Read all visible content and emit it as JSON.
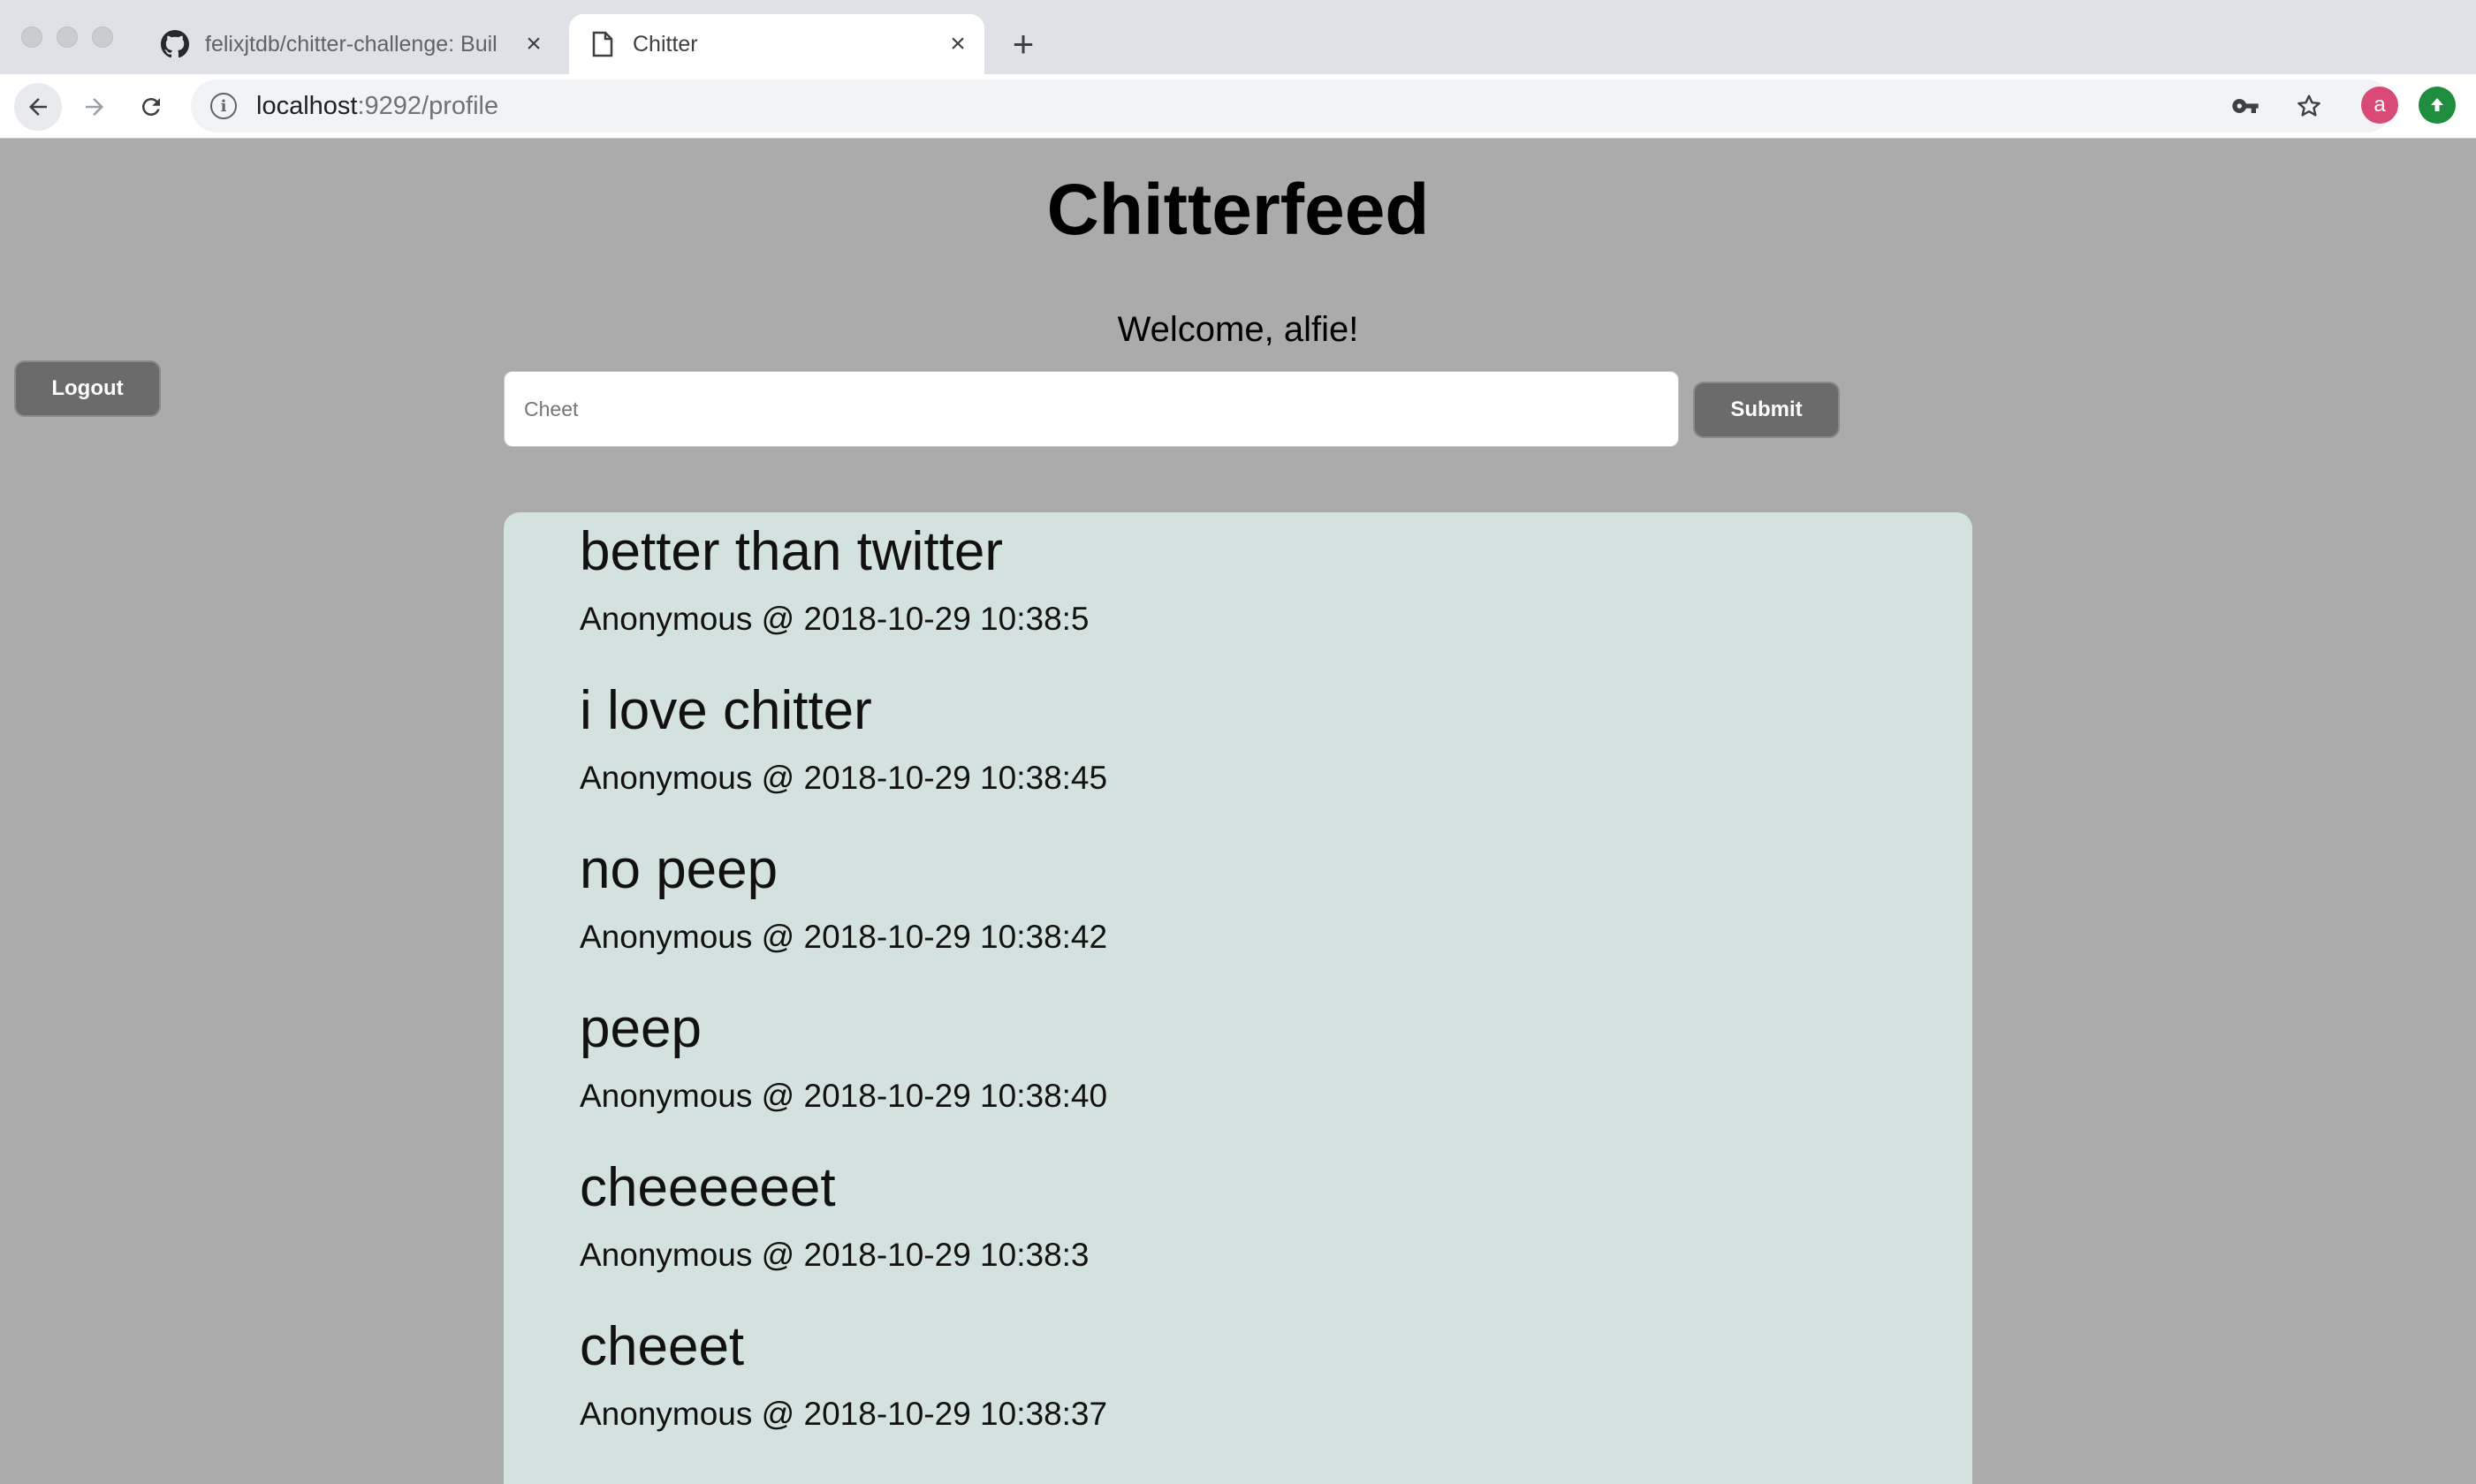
{
  "browser": {
    "tabs": [
      {
        "title": "felixjtdb/chitter-challenge: Buil",
        "icon": "github-icon",
        "active": false
      },
      {
        "title": "Chitter",
        "icon": "document-icon",
        "active": true
      }
    ],
    "url_host": "localhost",
    "url_path": ":9292/profile",
    "profile_initial": "a"
  },
  "page": {
    "title": "Chitterfeed",
    "welcome": "Welcome, alfie!",
    "logout_label": "Logout",
    "cheet_placeholder": "Cheet",
    "submit_label": "Submit"
  },
  "peeps": [
    {
      "text": "better than twitter",
      "meta": "Anonymous @ 2018-10-29 10:38:5"
    },
    {
      "text": "i love chitter",
      "meta": "Anonymous @ 2018-10-29 10:38:45"
    },
    {
      "text": "no peep",
      "meta": "Anonymous @ 2018-10-29 10:38:42"
    },
    {
      "text": "peep",
      "meta": "Anonymous @ 2018-10-29 10:38:40"
    },
    {
      "text": "cheeeeeet",
      "meta": "Anonymous @ 2018-10-29 10:38:3"
    },
    {
      "text": "cheeet",
      "meta": "Anonymous @ 2018-10-29 10:38:37"
    }
  ],
  "colors": {
    "page_bg": "#ababab",
    "feed_bg": "#d4e2df",
    "button_bg": "#6b6b6b",
    "avatar_bg": "#d94a77",
    "update_bg": "#1e8e3e"
  }
}
